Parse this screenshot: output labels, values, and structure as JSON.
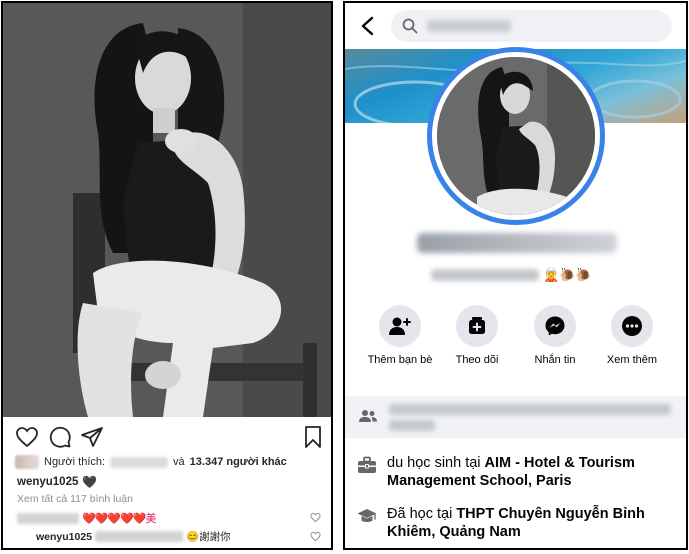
{
  "instagram": {
    "likes": {
      "prefix": "Người thích:",
      "connector": "và",
      "count_text": "13.347 người khác"
    },
    "caption": {
      "username": "wenyu1025",
      "emoji": "🖤"
    },
    "view_all_comments": "Xem tất cả 117 bình luận",
    "comments": [
      {
        "username": "",
        "text": "❤️❤️❤️❤️❤️美"
      },
      {
        "username": "wenyu1025",
        "text": "😊謝謝你"
      }
    ],
    "icons": [
      "heart-icon",
      "comment-icon",
      "share-icon",
      "bookmark-icon"
    ]
  },
  "facebook": {
    "bio_emoji": "🧝🐌🐌",
    "buttons": [
      {
        "label": "Thêm bạn bè",
        "icon": "add-friend-icon"
      },
      {
        "label": "Theo dõi",
        "icon": "follow-icon"
      },
      {
        "label": "Nhắn tin",
        "icon": "messenger-icon"
      },
      {
        "label": "Xem thêm",
        "icon": "more-icon"
      }
    ],
    "info": [
      {
        "prefix": "du học sinh tại",
        "place": "AIM - Hotel & Tourism Management School, Paris",
        "icon": "briefcase-icon"
      },
      {
        "prefix": "Đã học tại",
        "place": "THPT Chuyên Nguyễn Bỉnh Khiêm, Quảng Nam",
        "icon": "graduation-cap-icon"
      }
    ],
    "accent_color": "#3b82e8"
  }
}
